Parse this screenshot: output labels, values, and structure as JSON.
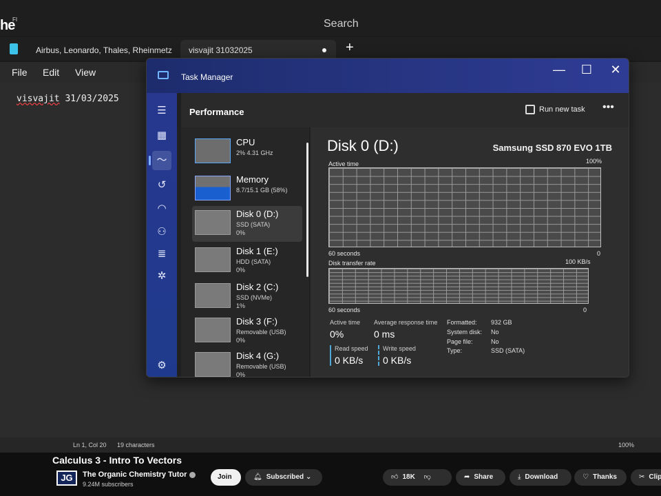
{
  "browser": {
    "brand": "he",
    "brand_sup": "FI",
    "search_label": "Search"
  },
  "notepad": {
    "tabs": [
      {
        "label": "Airbus, Leonardo, Thales, Rheinmetz"
      },
      {
        "label": "visvajit 31032025"
      }
    ],
    "new_tab": "+",
    "menu": {
      "file": "File",
      "edit": "Edit",
      "view": "View"
    },
    "text_name": "visvajit",
    "text_rest": " 31/03/2025",
    "status": {
      "position": "Ln 1, Col 20",
      "chars": "19 characters",
      "zoom": "100%"
    }
  },
  "task_manager": {
    "title": "Task Manager",
    "controls": {
      "minimize": "—",
      "maximize": "☐",
      "close": "✕"
    },
    "header": {
      "title": "Performance",
      "run_new_task": "Run new task",
      "more": "•••"
    },
    "list": [
      {
        "title": "CPU",
        "sub": "2% 4.31 GHz",
        "val": ""
      },
      {
        "title": "Memory",
        "sub": "8.7/15.1 GB (58%)",
        "val": ""
      },
      {
        "title": "Disk 0 (D:)",
        "sub": "SSD (SATA)",
        "val": "0%"
      },
      {
        "title": "Disk 1 (E:)",
        "sub": "HDD (SATA)",
        "val": "0%"
      },
      {
        "title": "Disk 2 (C:)",
        "sub": "SSD (NVMe)",
        "val": "1%"
      },
      {
        "title": "Disk 3 (F:)",
        "sub": "Removable (USB)",
        "val": "0%"
      },
      {
        "title": "Disk 4 (G:)",
        "sub": "Removable (USB)",
        "val": "0%"
      }
    ],
    "detail": {
      "title": "Disk 0 (D:)",
      "model": "Samsung SSD 870 EVO 1TB",
      "graph1": {
        "label": "Active time",
        "max": "100%",
        "time": "60 seconds",
        "min": "0"
      },
      "graph2": {
        "label": "Disk transfer rate",
        "max": "100 KB/s",
        "time": "60 seconds",
        "min": "0"
      },
      "stats": {
        "active_time_label": "Active time",
        "active_time": "0%",
        "avg_resp_label": "Average response time",
        "avg_resp": "0 ms",
        "read_label": "Read speed",
        "read": "0 KB/s",
        "write_label": "Write speed",
        "write": "0 KB/s"
      },
      "props": {
        "formatted_label": "Formatted:",
        "formatted": "932 GB",
        "system_label": "System disk:",
        "system": "No",
        "pagefile_label": "Page file:",
        "pagefile": "No",
        "type_label": "Type:",
        "type": "SSD (SATA)"
      }
    }
  },
  "youtube": {
    "video_title": "Calculus 3 - Intro To Vectors",
    "avatar": "JG",
    "channel": "The Organic Chemistry Tutor",
    "subscribers": "9.24M subscribers",
    "join": "Join",
    "subscribed": "Subscribed",
    "likes": "18K",
    "share": "Share",
    "download": "Download",
    "thanks": "Thanks",
    "clip": "Clip"
  },
  "colors": {
    "tm_accent": "#2f3c95",
    "memory_bar": "#1a5fd0",
    "io_line": "#4fa8d8"
  }
}
